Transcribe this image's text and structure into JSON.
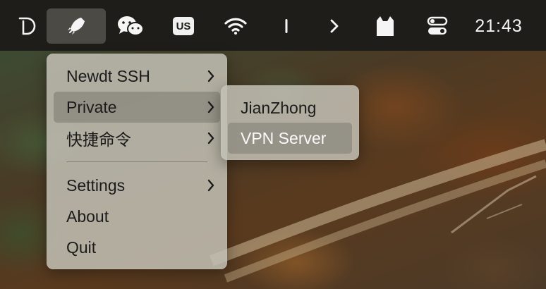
{
  "menubar": {
    "items": [
      {
        "name": "d-app-icon"
      },
      {
        "name": "rocket-app-icon"
      },
      {
        "name": "wechat-icon"
      },
      {
        "name": "input-source",
        "label": "US"
      },
      {
        "name": "wifi-icon"
      },
      {
        "name": "divider-icon"
      },
      {
        "name": "chevron-right-icon"
      },
      {
        "name": "cat-icon"
      },
      {
        "name": "control-center-icon"
      }
    ],
    "input_source_label": "US",
    "clock": "21:43"
  },
  "main_menu": {
    "items": [
      {
        "label": "Newdt SSH",
        "submenu": true
      },
      {
        "label": "Private",
        "submenu": true
      },
      {
        "label": "快捷命令",
        "submenu": true
      },
      {
        "label": "Settings",
        "submenu": true
      },
      {
        "label": "About",
        "submenu": false
      },
      {
        "label": "Quit",
        "submenu": false
      }
    ]
  },
  "sub_menu": {
    "items": [
      {
        "label": "JianZhong"
      },
      {
        "label": "VPN Server"
      }
    ]
  },
  "colors": {
    "menubar_bg": "#1e1d19",
    "menu_bg": "#c3c0b4",
    "highlight": "#7d7b73"
  }
}
